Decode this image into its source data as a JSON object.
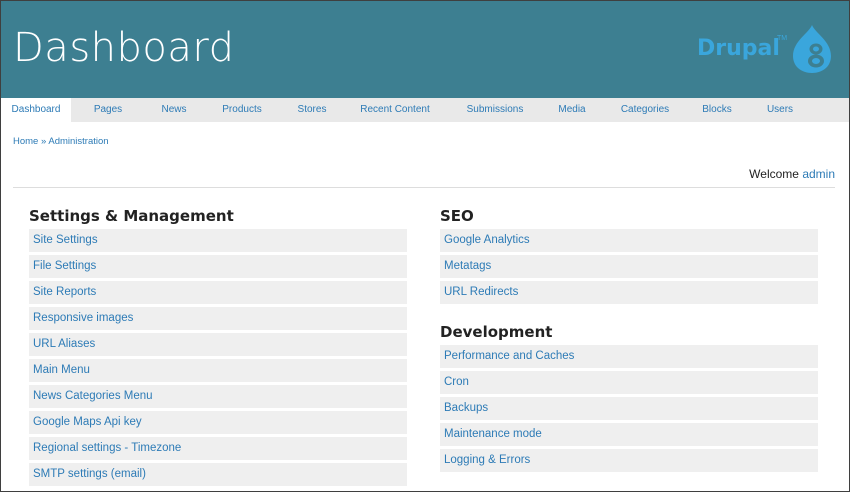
{
  "header": {
    "title": "Dashboard",
    "logo_text": "Drupal",
    "logo_tm": "TM"
  },
  "tabs": [
    {
      "label": "Dashboard"
    },
    {
      "label": "Pages"
    },
    {
      "label": "News"
    },
    {
      "label": "Products"
    },
    {
      "label": "Stores"
    },
    {
      "label": "Recent Content"
    },
    {
      "label": "Submissions"
    },
    {
      "label": "Media"
    },
    {
      "label": "Categories"
    },
    {
      "label": "Blocks"
    },
    {
      "label": "Users"
    }
  ],
  "breadcrumb": "Home » Administration",
  "welcome": {
    "prefix": "Welcome",
    "user": "admin"
  },
  "settings": {
    "title": "Settings & Management",
    "items": [
      "Site Settings",
      "File Settings",
      "Site Reports",
      "Responsive images",
      "URL Aliases",
      "Main Menu",
      "News Categories Menu",
      "Google Maps Api key",
      "Regional settings - Timezone",
      "SMTP settings (email)"
    ]
  },
  "seo": {
    "title": "SEO",
    "items": [
      "Google Analytics",
      "Metatags",
      "URL Redirects"
    ]
  },
  "development": {
    "title": "Development",
    "items": [
      "Performance and Caches",
      "Cron",
      "Backups",
      "Maintenance mode",
      "Logging & Errors"
    ]
  },
  "colors": {
    "header_bg": "#3d7f91",
    "link": "#2d7bb6",
    "drupal_blue": "#3aa6dc"
  },
  "icons": {
    "logo": "drupal-8-drop-icon"
  }
}
